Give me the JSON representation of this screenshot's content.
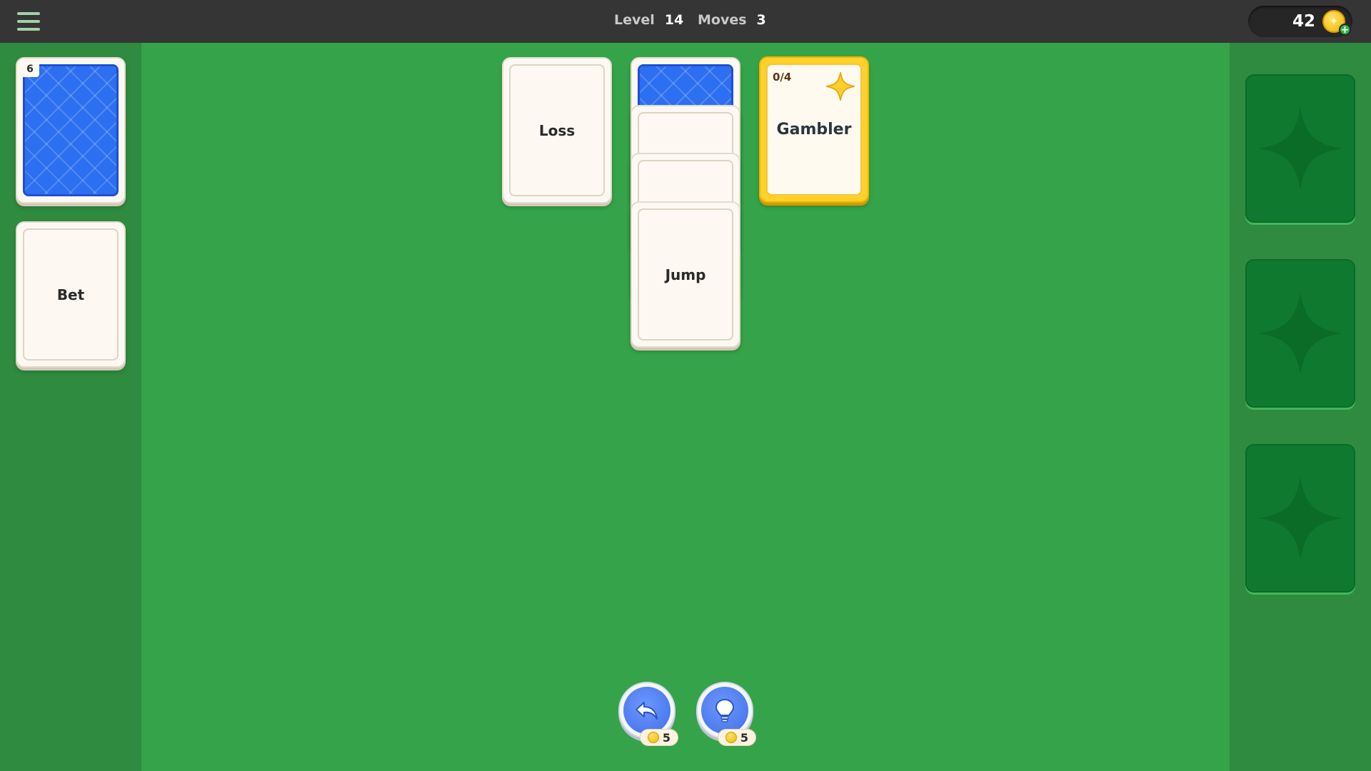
{
  "header": {
    "level_label": "Level",
    "level_value": "14",
    "moves_label": "Moves",
    "moves_value": "3",
    "coins": "42",
    "coin_plus": "+"
  },
  "stock": {
    "count": "6"
  },
  "waste": {
    "label": "Bet"
  },
  "tableau": {
    "column1_card": "Loss",
    "column2_top": "Jump"
  },
  "category": {
    "progress": "0/4",
    "name": "Gambler",
    "progress_value": 0,
    "progress_total": 4
  },
  "actions": {
    "undo_cost": "5",
    "hint_cost": "5"
  },
  "icons": {
    "menu": "hamburger-menu-icon",
    "coin": "coin-icon",
    "plus": "plus-icon",
    "sparkle": "sparkle-icon",
    "undo": "undo-arrow-icon",
    "hint": "lightbulb-icon"
  },
  "colors": {
    "table_green": "#35a34a",
    "panel_green": "#2e8b40",
    "slot_green": "#0f7a2f",
    "topbar": "#353535",
    "card_back_blue": "#2c6ff0",
    "category_gold": "#ffd12a",
    "action_blue": "#4f7ef2"
  }
}
